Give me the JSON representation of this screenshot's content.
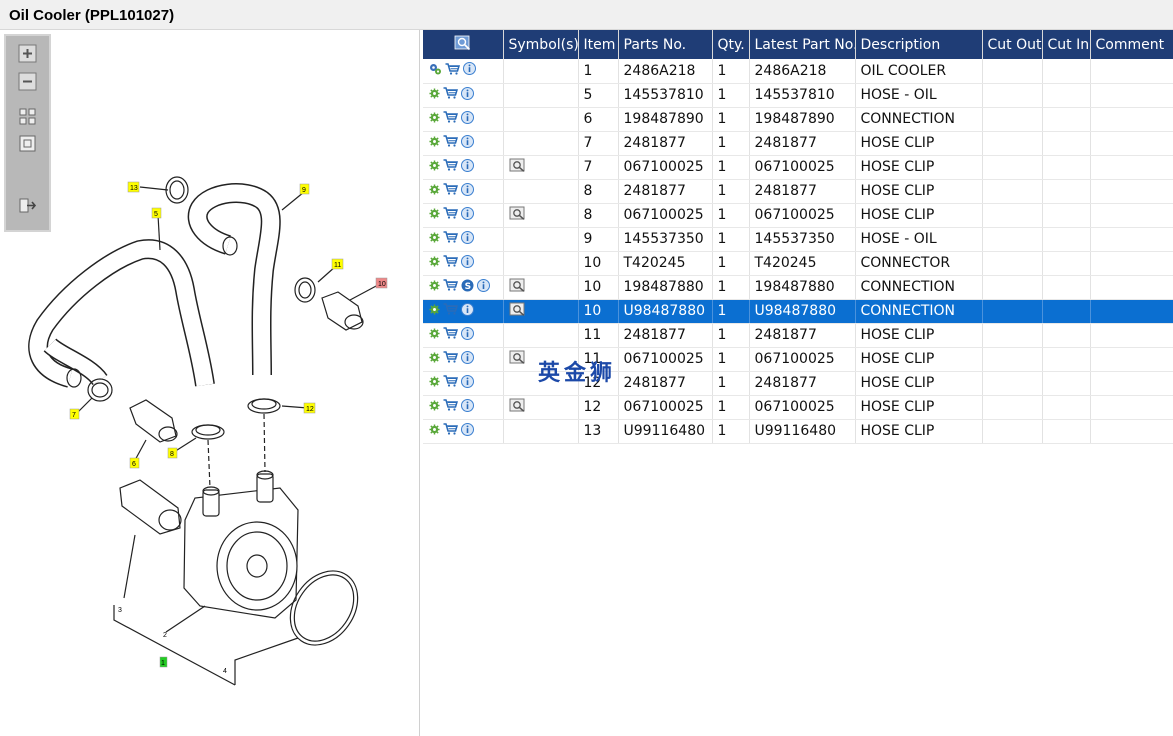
{
  "window": {
    "title": "Oil Cooler (PPL101027)"
  },
  "toolbar": {
    "buttons": [
      {
        "name": "zoom-in-button",
        "icon": "zoom-in-icon"
      },
      {
        "name": "zoom-out-button",
        "icon": "zoom-out-icon"
      },
      {
        "name": "fit-all-button",
        "icon": "grid-icon"
      },
      {
        "name": "fit-window-button",
        "icon": "frame-icon"
      },
      {
        "name": "export-button",
        "icon": "export-icon"
      }
    ]
  },
  "diagram": {
    "callouts": {
      "c13": "13",
      "c5": "5",
      "c9": "9",
      "c11": "11",
      "c10": "10",
      "c7": "7",
      "c6": "6",
      "c8": "8",
      "c12": "12",
      "c3": "3",
      "c2": "2",
      "c1": "1",
      "c4": "4"
    },
    "callout_colors": {
      "default": "#ffff00",
      "c10": "#ee8888",
      "c1": "#22cc22"
    }
  },
  "table": {
    "headers": {
      "icon": "",
      "symbols": "Symbol(s)",
      "item": "Item",
      "part_no": "Parts No.",
      "qty": "Qty.",
      "latest": "Latest Part No.",
      "desc": "Description",
      "cut_out": "Cut Out",
      "cut_in": "Cut In",
      "comment": "Comment"
    },
    "rows": [
      {
        "item": "1",
        "part_no": "2486A218",
        "qty": "1",
        "latest": "2486A218",
        "desc": "OIL COOLER",
        "cut_out": "",
        "cut_in": "",
        "comment": ""
      },
      {
        "item": "5",
        "part_no": "145537810",
        "qty": "1",
        "latest": "145537810",
        "desc": "HOSE - OIL",
        "cut_out": "",
        "cut_in": "",
        "comment": ""
      },
      {
        "item": "6",
        "part_no": "198487890",
        "qty": "1",
        "latest": "198487890",
        "desc": "CONNECTION",
        "cut_out": "",
        "cut_in": "",
        "comment": ""
      },
      {
        "item": "7",
        "part_no": "2481877",
        "qty": "1",
        "latest": "2481877",
        "desc": "HOSE CLIP",
        "cut_out": "",
        "cut_in": "",
        "comment": ""
      },
      {
        "item": "7",
        "part_no": "067100025",
        "qty": "1",
        "latest": "067100025",
        "desc": "HOSE CLIP",
        "cut_out": "",
        "cut_in": "",
        "comment": ""
      },
      {
        "item": "8",
        "part_no": "2481877",
        "qty": "1",
        "latest": "2481877",
        "desc": "HOSE CLIP",
        "cut_out": "",
        "cut_in": "",
        "comment": ""
      },
      {
        "item": "8",
        "part_no": "067100025",
        "qty": "1",
        "latest": "067100025",
        "desc": "HOSE CLIP",
        "cut_out": "",
        "cut_in": "",
        "comment": ""
      },
      {
        "item": "9",
        "part_no": "145537350",
        "qty": "1",
        "latest": "145537350",
        "desc": "HOSE - OIL",
        "cut_out": "",
        "cut_in": "",
        "comment": ""
      },
      {
        "item": "10",
        "part_no": "T420245",
        "qty": "1",
        "latest": "T420245",
        "desc": "CONNECTOR",
        "cut_out": "",
        "cut_in": "",
        "comment": ""
      },
      {
        "item": "10",
        "part_no": "198487880",
        "qty": "1",
        "latest": "198487880",
        "desc": "CONNECTION",
        "cut_out": "",
        "cut_in": "",
        "comment": ""
      },
      {
        "item": "10",
        "part_no": "U98487880",
        "qty": "1",
        "latest": "U98487880",
        "desc": "CONNECTION",
        "cut_out": "",
        "cut_in": "",
        "comment": ""
      },
      {
        "item": "11",
        "part_no": "2481877",
        "qty": "1",
        "latest": "2481877",
        "desc": "HOSE CLIP",
        "cut_out": "",
        "cut_in": "",
        "comment": ""
      },
      {
        "item": "11",
        "part_no": "067100025",
        "qty": "1",
        "latest": "067100025",
        "desc": "HOSE CLIP",
        "cut_out": "",
        "cut_in": "",
        "comment": ""
      },
      {
        "item": "12",
        "part_no": "2481877",
        "qty": "1",
        "latest": "2481877",
        "desc": "HOSE CLIP",
        "cut_out": "",
        "cut_in": "",
        "comment": ""
      },
      {
        "item": "12",
        "part_no": "067100025",
        "qty": "1",
        "latest": "067100025",
        "desc": "HOSE CLIP",
        "cut_out": "",
        "cut_in": "",
        "comment": ""
      },
      {
        "item": "13",
        "part_no": "U99116480",
        "qty": "1",
        "latest": "U99116480",
        "desc": "HOSE CLIP",
        "cut_out": "",
        "cut_in": "",
        "comment": ""
      }
    ],
    "row_icons": [
      [
        "gears-icon",
        "cart-icon",
        "info-icon"
      ],
      [
        "gear-icon",
        "cart-icon",
        "info-icon"
      ],
      [
        "gear-icon",
        "cart-icon",
        "info-icon"
      ],
      [
        "gear-icon",
        "cart-icon",
        "info-icon"
      ],
      [
        "gear-icon",
        "cart-icon",
        "info-icon"
      ],
      [
        "gear-icon",
        "cart-icon",
        "info-icon"
      ],
      [
        "gear-icon",
        "cart-icon",
        "info-icon"
      ],
      [
        "gear-icon",
        "cart-icon",
        "info-icon"
      ],
      [
        "gear-icon",
        "cart-icon",
        "info-icon"
      ],
      [
        "gear-icon",
        "cart-icon",
        "supersession-icon",
        "info-icon"
      ],
      [
        "gear-icon",
        "cart-icon",
        "info-icon"
      ],
      [
        "gear-icon",
        "cart-icon",
        "info-icon"
      ],
      [
        "gear-icon",
        "cart-icon",
        "info-icon"
      ],
      [
        "gear-icon",
        "cart-icon",
        "info-icon"
      ],
      [
        "gear-icon",
        "cart-icon",
        "info-icon"
      ],
      [
        "gear-icon",
        "cart-icon",
        "info-icon"
      ]
    ],
    "symbol_rows": [
      false,
      false,
      false,
      false,
      true,
      false,
      true,
      false,
      false,
      true,
      true,
      false,
      true,
      false,
      true,
      false
    ],
    "selected_row": 10
  },
  "watermark": "英金狮",
  "colors": {
    "header_bg": "#1f3d76",
    "selected_row_bg": "#0b6fd1",
    "gear": "#5aa83a",
    "cart": "#2a6bb8",
    "info": "#3a7fd0"
  }
}
